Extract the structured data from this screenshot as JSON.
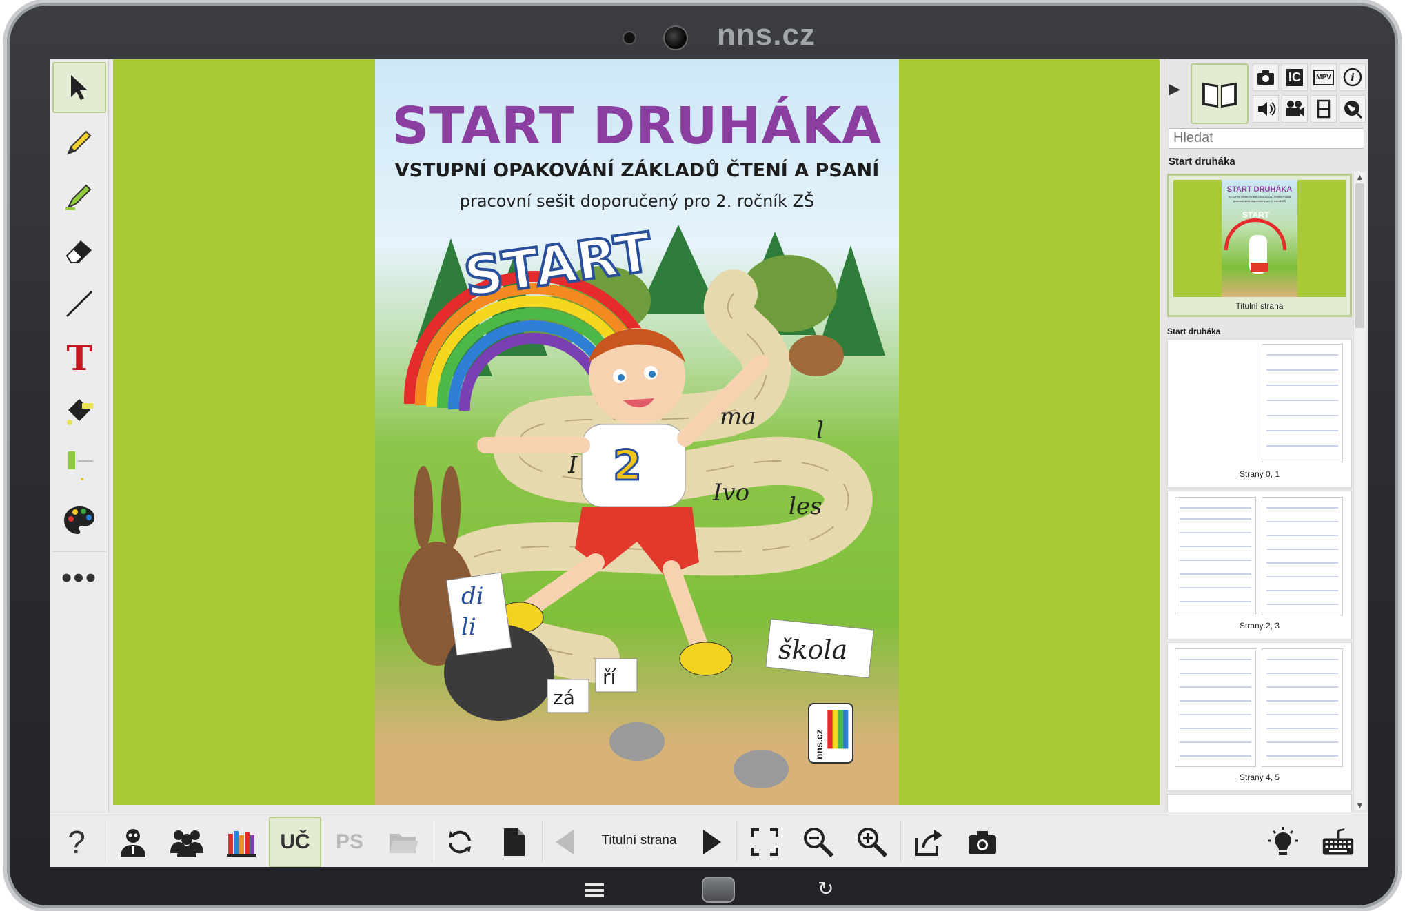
{
  "device": {
    "brand": "nns.cz"
  },
  "left_toolbar": {
    "tools": [
      {
        "name": "select-tool",
        "icon": "cursor-arrow-icon"
      },
      {
        "name": "pencil-tool",
        "icon": "pencil-icon"
      },
      {
        "name": "highlighter-tool",
        "icon": "highlighter-icon"
      },
      {
        "name": "eraser-tool",
        "icon": "eraser-icon"
      },
      {
        "name": "line-tool",
        "icon": "line-icon"
      },
      {
        "name": "text-tool",
        "icon": "text-t-icon",
        "label": "T"
      },
      {
        "name": "fill-tool",
        "icon": "paint-bucket-icon"
      },
      {
        "name": "stroke-width-tool",
        "icon": "width-slider-icon"
      },
      {
        "name": "color-palette-tool",
        "icon": "palette-icon"
      },
      {
        "name": "more-tools",
        "icon": "more-dots-icon",
        "label": "•••"
      }
    ]
  },
  "cover": {
    "title": "START DRUHÁKA",
    "subtitle": "VSTUPNÍ OPAKOVÁNÍ ZÁKLADŮ ČTENÍ A PSANÍ",
    "subtitle2": "pracovní sešit doporučený pro 2. ročník ZŠ",
    "rainbow_word": "START",
    "path_words": [
      "ma",
      "l",
      "Ivo",
      "les",
      "I",
      "di",
      "li",
      "zá",
      "ří",
      "škola",
      "2"
    ],
    "logo": "nns.cz"
  },
  "right_panel": {
    "search_placeholder": "Hledat",
    "book_title": "Start druháka",
    "section_title": "Start druháka",
    "thumbnails": [
      {
        "caption": "Titulní strana",
        "selected": true
      },
      {
        "caption": "Strany 0, 1"
      },
      {
        "caption": "Strany 2, 3"
      },
      {
        "caption": "Strany 4, 5"
      }
    ],
    "media_buttons": [
      "camera-icon",
      "ic-icon",
      "mpv-icon",
      "info-icon",
      "speaker-icon",
      "video-camera-icon",
      "film-icon",
      "globe-icon"
    ],
    "media_labels": {
      "ic": "IC",
      "mpv": "MPV"
    },
    "thumb_cover_mini": {
      "title": "START DRUHÁKA",
      "subtitle": "VSTUPNÍ OPAKOVÁNÍ ZÁKLADŮ ČTENÍ A PSANÍ",
      "subtitle2": "pracovní sešit doporučený pro 2. ročník ZŠ",
      "rainbow": "START"
    }
  },
  "bottom_toolbar": {
    "help": "?",
    "uc_label": "UČ",
    "ps_label": "PS",
    "current_page": "Titulní strana"
  },
  "colors": {
    "canvas_bg": "#a9c937",
    "title_purple": "#8a3fa0",
    "active_bg": "#e3ecd2",
    "active_border": "#b8cc8e"
  }
}
